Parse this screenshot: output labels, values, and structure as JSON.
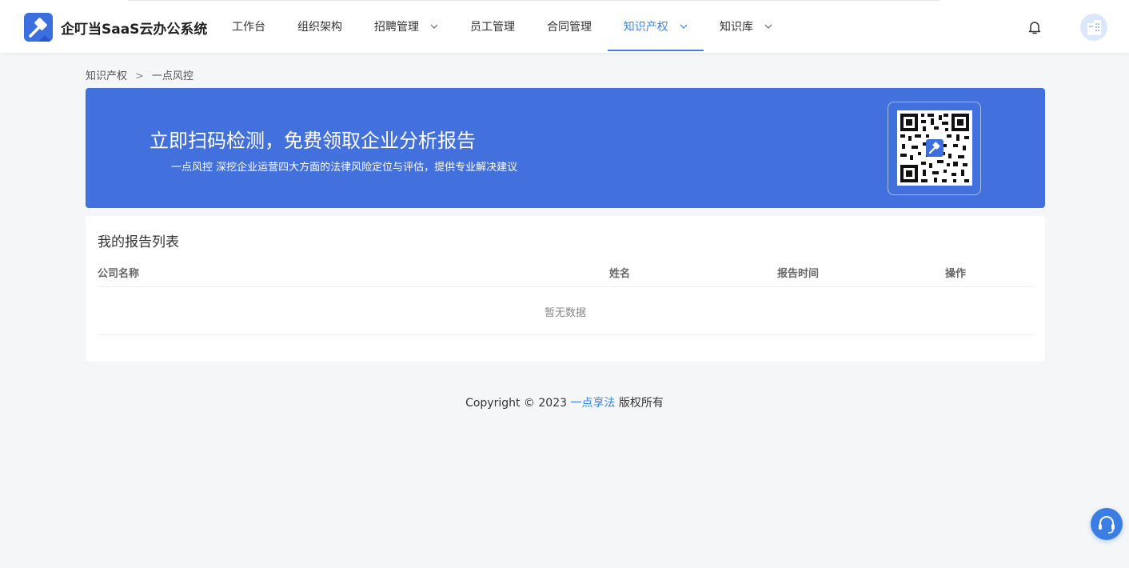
{
  "header": {
    "app_title": "企叮当SaaS云办公系统",
    "logo_icon": "gavel-icon",
    "nav": [
      {
        "label": "工作台"
      },
      {
        "label": "组织架构"
      },
      {
        "label": "招聘管理"
      },
      {
        "label": "员工管理"
      },
      {
        "label": "合同管理"
      },
      {
        "label": "知识产权"
      },
      {
        "label": "知识库"
      }
    ],
    "accent_color": "#3a86e8"
  },
  "breadcrumb": {
    "items": [
      "知识产权",
      "一点风控"
    ],
    "separator": ">"
  },
  "banner": {
    "title": "立即扫码检测，免费领取企业分析报告",
    "subtitle": "一点风控 深挖企业运营四大方面的法律风险定位与评估，提供专业解决建议",
    "background": "#4270dc"
  },
  "reports": {
    "title": "我的报告列表",
    "columns": [
      "公司名称",
      "姓名",
      "报告时间",
      "操作"
    ],
    "rows": [],
    "empty_text": "暂无数据"
  },
  "footer": {
    "prefix": "Copyright © 2023 ",
    "brand": "一点享法",
    "suffix": " 版权所有"
  }
}
